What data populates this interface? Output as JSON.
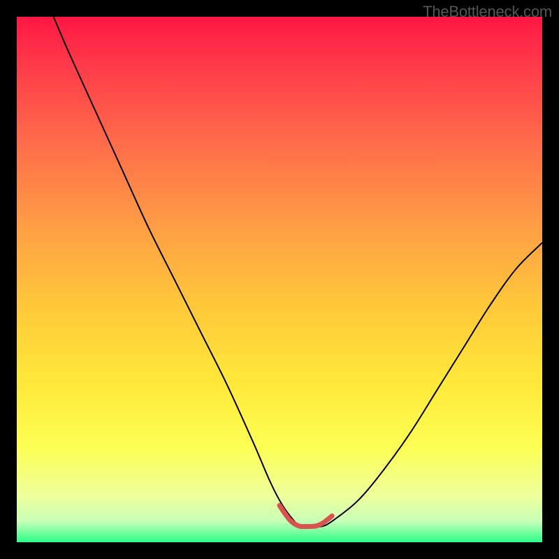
{
  "attribution": "TheBottleneck.com",
  "chart_data": {
    "type": "line",
    "title": "",
    "xlabel": "",
    "ylabel": "",
    "xlim": [
      0,
      100
    ],
    "ylim": [
      0,
      100
    ],
    "grid": false,
    "legend": false,
    "series": [
      {
        "name": "bottleneck-curve",
        "color": "#000000",
        "x": [
          7,
          10,
          15,
          20,
          25,
          30,
          35,
          40,
          45,
          48,
          50,
          52,
          54,
          56,
          58,
          60,
          65,
          70,
          75,
          80,
          85,
          90,
          95,
          100
        ],
        "y": [
          100,
          93,
          82,
          71,
          60,
          50,
          40,
          30,
          19,
          12,
          8,
          5,
          3,
          3,
          3,
          4,
          8,
          14,
          21,
          29,
          37,
          45,
          52,
          57
        ]
      },
      {
        "name": "sweet-spot-marker",
        "color": "#d9534f",
        "x": [
          50,
          51,
          52,
          53,
          54,
          55,
          56,
          57,
          58,
          59,
          60
        ],
        "y": [
          7,
          5.5,
          4.2,
          3.4,
          3,
          3,
          3,
          3.1,
          3.5,
          4.2,
          5
        ]
      }
    ],
    "background_gradient_stops": [
      {
        "offset": 0,
        "color": "#ff1744"
      },
      {
        "offset": 10,
        "color": "#ff3d4a"
      },
      {
        "offset": 25,
        "color": "#ff6f4a"
      },
      {
        "offset": 40,
        "color": "#ff9e45"
      },
      {
        "offset": 55,
        "color": "#ffc83a"
      },
      {
        "offset": 70,
        "color": "#ffe93a"
      },
      {
        "offset": 82,
        "color": "#fdff55"
      },
      {
        "offset": 91,
        "color": "#efff9a"
      },
      {
        "offset": 96,
        "color": "#c8ffb8"
      },
      {
        "offset": 100,
        "color": "#2bff8a"
      }
    ]
  }
}
